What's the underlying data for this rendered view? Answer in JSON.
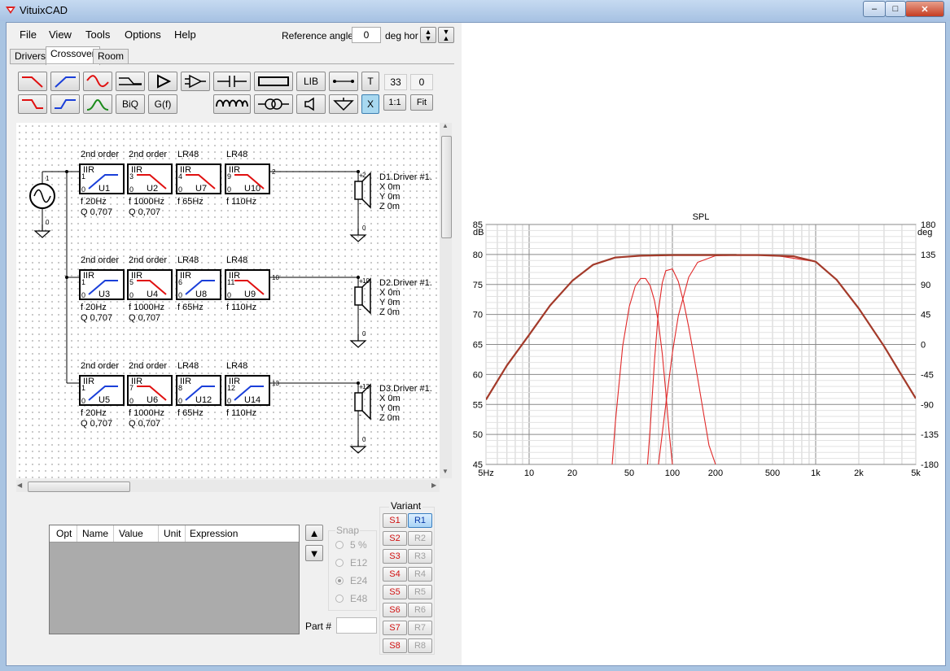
{
  "window": {
    "title": "VituixCAD"
  },
  "menu": [
    "File",
    "View",
    "Tools",
    "Options",
    "Help"
  ],
  "reference_angle": {
    "label": "Reference angle",
    "value": "0",
    "unit": "deg hor"
  },
  "tabs": [
    "Drivers",
    "Crossover",
    "Room"
  ],
  "toolbar": {
    "lib": "LIB",
    "biq": "BiQ",
    "gf": "G(f)",
    "t": "T",
    "x": "X",
    "count1": "33",
    "count2": "0",
    "one_to_one": "1:1",
    "fit": "Fit"
  },
  "schematic": {
    "source_node": "1",
    "source_ground": "0",
    "rows": [
      {
        "blocks": [
          {
            "header": "2nd order",
            "type": "IIR",
            "id": "U1",
            "in": "1",
            "out": "3",
            "gnd": "0",
            "shape": "hp",
            "params": [
              "f  20Hz",
              "Q  0,707"
            ]
          },
          {
            "header": "2nd order",
            "type": "IIR",
            "id": "U2",
            "in": "3",
            "out": "4",
            "gnd": "0",
            "shape": "lp",
            "params": [
              "f  1000Hz",
              "Q  0,707"
            ]
          },
          {
            "header": "LR48",
            "type": "IIR",
            "id": "U7",
            "in": "4",
            "out": "9",
            "gnd": "0",
            "shape": "lp",
            "params": [
              "f  65Hz"
            ]
          },
          {
            "header": "LR48",
            "type": "IIR",
            "id": "U10",
            "in": "9",
            "out": "2",
            "gnd": "0",
            "shape": "lp",
            "params": [
              "f  110Hz"
            ]
          }
        ],
        "driver": {
          "name": "D1.Driver #1.",
          "x": "X 0m",
          "y": "Y 0m",
          "z": "Z 0m",
          "node": "2",
          "gnd": "0"
        }
      },
      {
        "blocks": [
          {
            "header": "2nd order",
            "type": "IIR",
            "id": "U3",
            "in": "1",
            "out": "5",
            "gnd": "0",
            "shape": "hp",
            "params": [
              "f  20Hz",
              "Q  0,707"
            ]
          },
          {
            "header": "2nd order",
            "type": "IIR",
            "id": "U4",
            "in": "5",
            "out": "6",
            "gnd": "0",
            "shape": "lp",
            "params": [
              "f  1000Hz",
              "Q  0,707"
            ]
          },
          {
            "header": "LR48",
            "type": "IIR",
            "id": "U8",
            "in": "6",
            "out": "11",
            "gnd": "0",
            "shape": "hp",
            "params": [
              "f  65Hz"
            ]
          },
          {
            "header": "LR48",
            "type": "IIR",
            "id": "U9",
            "in": "11",
            "out": "10",
            "gnd": "0",
            "shape": "lp",
            "params": [
              "f  110Hz"
            ]
          }
        ],
        "driver": {
          "name": "D2.Driver #1.",
          "x": "X 0m",
          "y": "Y 0m",
          "z": "Z 0m",
          "node": "10",
          "gnd": "0"
        }
      },
      {
        "blocks": [
          {
            "header": "2nd order",
            "type": "IIR",
            "id": "U5",
            "in": "1",
            "out": "7",
            "gnd": "0",
            "shape": "hp",
            "params": [
              "f  20Hz",
              "Q  0,707"
            ]
          },
          {
            "header": "2nd order",
            "type": "IIR",
            "id": "U6",
            "in": "7",
            "out": "8",
            "gnd": "0",
            "shape": "lp",
            "params": [
              "f  1000Hz",
              "Q  0,707"
            ]
          },
          {
            "header": "LR48",
            "type": "IIR",
            "id": "U12",
            "in": "8",
            "out": "12",
            "gnd": "0",
            "shape": "hp",
            "params": [
              "f  65Hz"
            ]
          },
          {
            "header": "LR48",
            "type": "IIR",
            "id": "U14",
            "in": "12",
            "out": "13",
            "gnd": "0",
            "shape": "hp",
            "params": [
              "f  110Hz"
            ]
          }
        ],
        "driver": {
          "name": "D3.Driver #1.",
          "x": "X 0m",
          "y": "Y 0m",
          "z": "Z 0m",
          "node": "13",
          "gnd": "0"
        }
      }
    ]
  },
  "param_table": {
    "columns": [
      "Opt",
      "Name",
      "Value",
      "Unit",
      "Expression"
    ]
  },
  "snap": {
    "label": "Snap",
    "options": [
      "5 %",
      "E12",
      "E24",
      "E48"
    ],
    "selected": "E24"
  },
  "part": {
    "label": "Part #"
  },
  "variant": {
    "label": "Variant",
    "s": [
      "S1",
      "S2",
      "S3",
      "S4",
      "S5",
      "S6",
      "S7",
      "S8"
    ],
    "r": [
      "R1",
      "R2",
      "R3",
      "R4",
      "R5",
      "R6",
      "R7",
      "R8"
    ]
  },
  "colors": {
    "highpass": "#1a3fd9",
    "lowpass": "#e01010",
    "bandpass": "#1a8a1a",
    "sum": "#a33a2a",
    "partial": "#e02828"
  },
  "chart_data": {
    "type": "line",
    "title": "SPL",
    "ylabel_left": "dB",
    "ylabel_right": "deg",
    "xscale": "log",
    "xlim": [
      5,
      5000
    ],
    "ylim": [
      45,
      85
    ],
    "y2lim": [
      -180,
      180
    ],
    "x_ticks": [
      "5Hz",
      "10",
      "20",
      "50",
      "100",
      "200",
      "500",
      "1k",
      "2k",
      "5k"
    ],
    "y_ticks": [
      "45",
      "50",
      "55",
      "60",
      "65",
      "70",
      "75",
      "80",
      "85"
    ],
    "y2_ticks": [
      "-180",
      "-135",
      "-90",
      "-45",
      "0",
      "45",
      "90",
      "135",
      "180"
    ],
    "grid": true,
    "series": [
      {
        "role": "sum",
        "color": "#a33a2a",
        "x": [
          5,
          7,
          10,
          14,
          20,
          28,
          40,
          60,
          100,
          200,
          400,
          700,
          1000,
          1400,
          2000,
          3000,
          4000,
          5000
        ],
        "y": [
          55.8,
          61.5,
          66.6,
          71.5,
          75.6,
          78.3,
          79.5,
          79.8,
          79.9,
          79.9,
          79.9,
          79.7,
          78.8,
          75.8,
          71.0,
          64.7,
          59.8,
          56.0
        ]
      },
      {
        "role": "driver-1",
        "color": "#e02828",
        "x": [
          38,
          40,
          45,
          50,
          55,
          60,
          65,
          70,
          75,
          80,
          85,
          90,
          95,
          100
        ],
        "y": [
          45,
          52.0,
          64.7,
          71.3,
          74.7,
          76.0,
          76.0,
          74.8,
          72.3,
          68.6,
          63.4,
          57.0,
          50.2,
          45
        ]
      },
      {
        "role": "driver-2",
        "color": "#e02828",
        "x": [
          67,
          70,
          75,
          80,
          85,
          90,
          100,
          110,
          120,
          130,
          140,
          150,
          165,
          180,
          200
        ],
        "y": [
          45,
          51.0,
          62.3,
          70.7,
          75.3,
          77.3,
          77.6,
          75.5,
          72.0,
          67.9,
          63.6,
          59.4,
          53.5,
          48.2,
          45
        ]
      },
      {
        "role": "driver-3",
        "color": "#e02828",
        "x": [
          80,
          90,
          100,
          110,
          130,
          150,
          200,
          300,
          500,
          1000,
          1400,
          2000,
          3000,
          5000
        ],
        "y": [
          45,
          55.0,
          63.6,
          69.8,
          76.2,
          78.7,
          79.8,
          79.9,
          79.9,
          78.8,
          75.8,
          71.0,
          64.7,
          56.0
        ]
      },
      {
        "role": "phase-trace",
        "color": "#8a9a8a",
        "x": [
          60,
          80,
          100,
          150,
          200,
          280
        ],
        "y": [
          79.9,
          80.0,
          80.0,
          80.0,
          80.0,
          80.0
        ]
      }
    ]
  }
}
